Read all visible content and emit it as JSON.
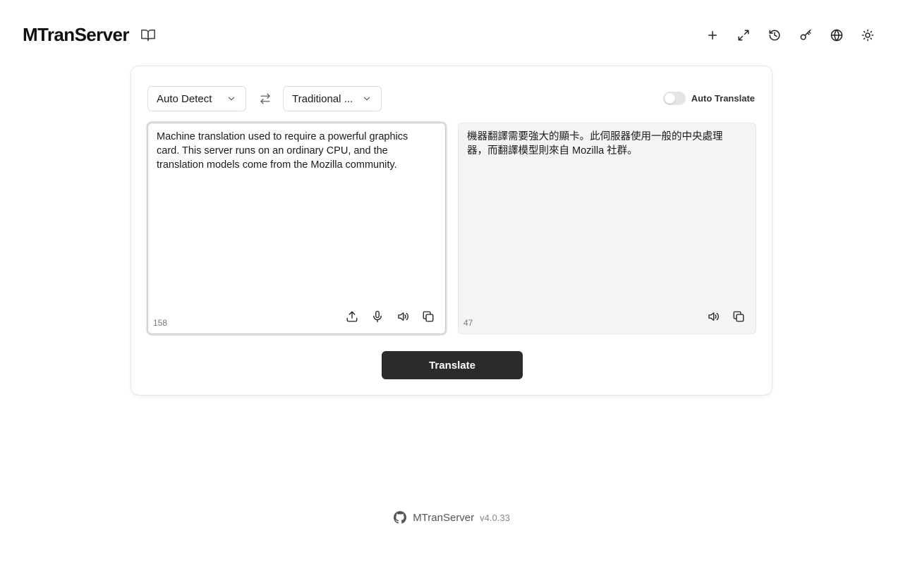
{
  "header": {
    "brand": "MTranServer",
    "icons": {
      "docs": "book-open-icon",
      "new": "plus-icon",
      "fullscreen": "expand-icon",
      "history": "history-icon",
      "api_key": "key-icon",
      "language": "globe-icon",
      "theme": "sun-icon"
    }
  },
  "translator": {
    "source_language": "Auto Detect",
    "target_language": "Traditional ...",
    "auto_translate_label": "Auto Translate",
    "auto_translate_enabled": false,
    "source": {
      "text": "Machine translation used to require a powerful graphics card. This server runs on an ordinary CPU, and the translation models come from the Mozilla community.",
      "char_count": "158"
    },
    "target": {
      "text": "機器翻譯需要強大的顯卡。此伺服器使用一般的中央處理器，而翻譯模型則來自 Mozilla 社群。",
      "char_count": "47"
    },
    "translate_label": "Translate"
  },
  "footer": {
    "name": "MTranServer",
    "version": "v4.0.33"
  },
  "colors": {
    "primary_button": "#2b2b2b",
    "target_panel_bg": "#f4f4f4"
  }
}
